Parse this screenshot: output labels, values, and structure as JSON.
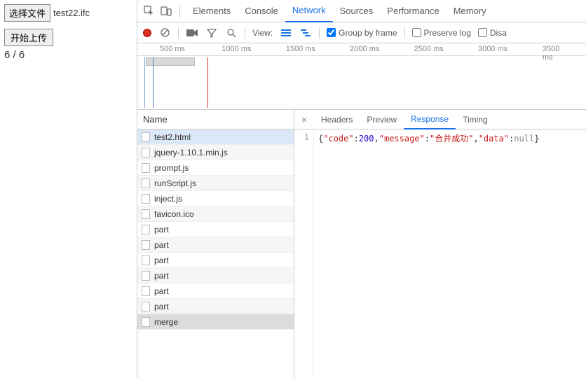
{
  "page": {
    "file_button": "选择文件",
    "file_name": "test22.ifc",
    "upload_button": "开始上传",
    "progress": "6 / 6"
  },
  "devtools": {
    "tabs": [
      "Elements",
      "Console",
      "Network",
      "Sources",
      "Performance",
      "Memory"
    ],
    "active_tab": 2,
    "toolbar": {
      "view_label": "View:",
      "group_by_frame": "Group by frame",
      "preserve_log": "Preserve log",
      "disable_cache": "Disa",
      "group_checked": true,
      "preserve_checked": false,
      "disable_checked": false
    },
    "timeline_ticks": [
      "500 ms",
      "1000 ms",
      "1500 ms",
      "2000 ms",
      "2500 ms",
      "3000 ms",
      "3500 ms"
    ],
    "name_header": "Name",
    "requests": [
      "test2.html",
      "jquery-1.10.1.min.js",
      "prompt.js",
      "runScript.js",
      "inject.js",
      "favicon.ico",
      "part",
      "part",
      "part",
      "part",
      "part",
      "part",
      "merge"
    ],
    "selected_index": 0,
    "grey_selected_index": 12,
    "detail_tabs": [
      "Headers",
      "Preview",
      "Response",
      "Timing"
    ],
    "detail_active": 2,
    "response_line_no": "1",
    "response_json": {
      "code": 200,
      "message": "合并成功",
      "data": null
    }
  }
}
